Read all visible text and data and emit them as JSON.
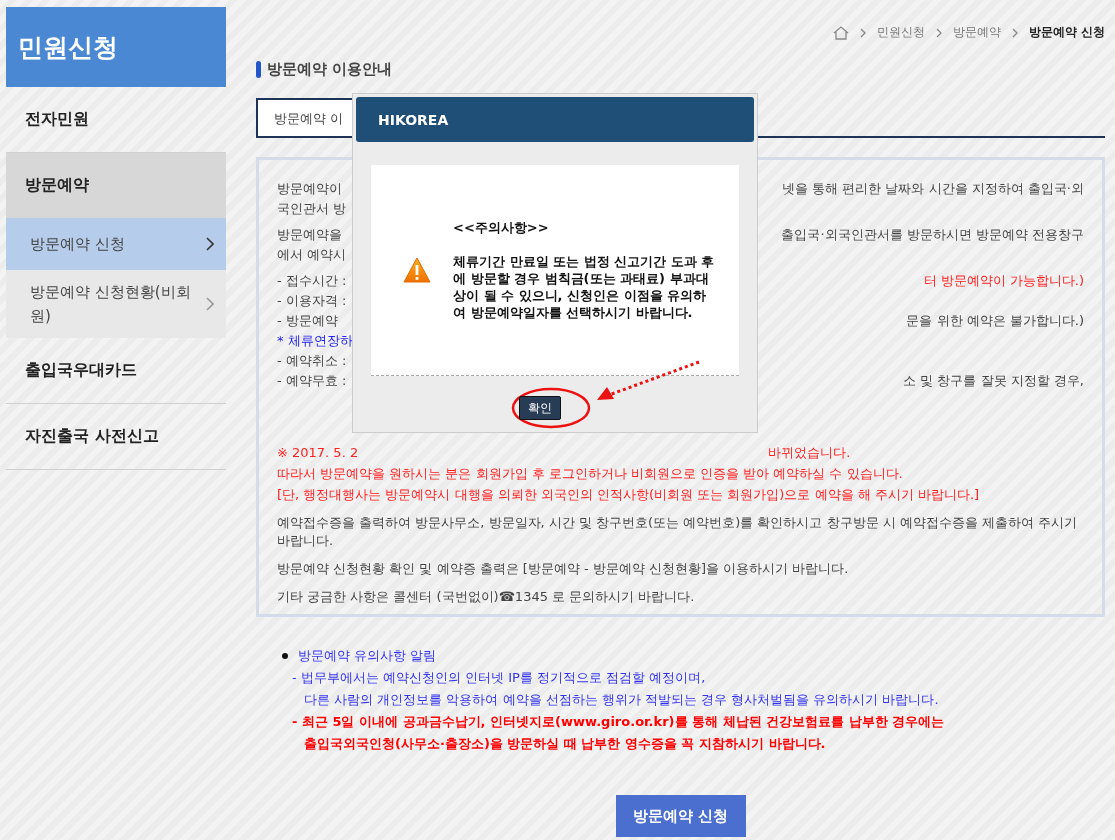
{
  "sidebar": {
    "title": "민원신청",
    "items": [
      {
        "label": "전자민원",
        "selected": false
      },
      {
        "label": "방문예약",
        "selected": true,
        "children": [
          {
            "label": "방문예약 신청",
            "selected": true
          },
          {
            "label": "방문예약 신청현황(비회원)",
            "selected": false
          }
        ]
      },
      {
        "label": "출입국우대카드",
        "selected": false
      },
      {
        "label": "자진출국 사전신고",
        "selected": false
      }
    ]
  },
  "breadcrumb": [
    "민원신청",
    "방문예약",
    "방문예약 신청"
  ],
  "section_title": "방문예약 이용안내",
  "tab": {
    "label": "방문예약 이",
    "selected": true
  },
  "notice_blocks": [
    {
      "lines": [
        {
          "left": "방문예약이",
          "right": {
            "text": "넷을 통해 편리한 날짜와 시간을 지정하여 출입국·외"
          }
        },
        {
          "left": "국인관서 방"
        }
      ]
    },
    {
      "lines": [
        {
          "left": "방문예약을",
          "right": {
            "text": "출입국·외국인관서를 방문하시면 방문예약 전용창구"
          }
        },
        {
          "left": "에서 예약시"
        }
      ]
    },
    {
      "lines": [
        {
          "left": "- 접수시간 :",
          "right": {
            "text": "터 방문예약이 가능합니다.)",
            "color": "#ff2020"
          }
        },
        {
          "left": "- 이용자격 :"
        },
        {
          "left": "- 방문예약",
          "right": {
            "text": "문을 위한 예약은 불가합니다.)"
          }
        },
        {
          "left": "* 체류연장하",
          "color": "#2222ee"
        },
        {
          "left": "- 예약취소 :"
        },
        {
          "left": "- 예약무효 :",
          "right": {
            "text": "소 및 창구를 잘못 지정할 경우,"
          }
        }
      ]
    }
  ],
  "red_lines": [
    {
      "left": "※ 2017. 5. 2",
      "right": "바뀌었습니다."
    }
  ],
  "red_paragraphs": [
    "따라서 방문예약을 원하시는 분은 회원가입 후 로그인하거나 비회원으로 인증을 받아 예약하실 수 있습니다.",
    "[단, 행정대행사는 방문예약시 대행을 의뢰한 외국인의 인적사항(비회원 또는 회원가입)으로 예약을 해 주시기 바랍니다.]"
  ],
  "paragraphs": [
    "예약접수증을 출력하여 방문사무소, 방문일자, 시간 및 창구번호(또는 예약번호)를 확인하시고 창구방문 시 예약접수증을 제출하여 주시기 바랍니다.",
    "방문예약 신청현황 확인 및 예약증 출력은 [방문예약 - 방문예약 신청현황]을 이용하시기 바랍니다.",
    "기타 궁금한 사항은 콜센터 (국번없이)☎1345 로 문의하시기 바랍니다."
  ],
  "alert": {
    "title": "방문예약 유의사항 알림",
    "items": [
      {
        "lines": [
          "- 법무부에서는 예약신청인의 인터넷 IP를 정기적으로 점검할 예정이며,",
          "다른 사람의 개인정보를 악용하여 예약을 선점하는 행위가 적발되는 경우 형사처벌됨을 유의하시기 바랍니다."
        ],
        "color": "#3333ee"
      },
      {
        "lines": [
          "- 최근 5일 이내에 공과금수납기, 인터넷지로(www.giro.or.kr)를 통해 체납된 건강보험료를 납부한 경우에는",
          "출입국외국인청(사무소·출장소)을 방문하실 때 납부한 영수증을 꼭 지참하시기 바랍니다."
        ],
        "color": "#ff0000"
      }
    ]
  },
  "apply_button": "방문예약 신청",
  "modal": {
    "title": "HIKOREA",
    "heading": "<<주의사항>>",
    "message": "체류기간 만료일 또는 법정 신고기간 도과 후에 방문할 경우 범칙금(또는 과태료) 부과대상이 될 수 있으니, 신청인은 이점을 유의하여 방문예약일자를 선택하시기 바랍니다.",
    "confirm": "확인"
  }
}
